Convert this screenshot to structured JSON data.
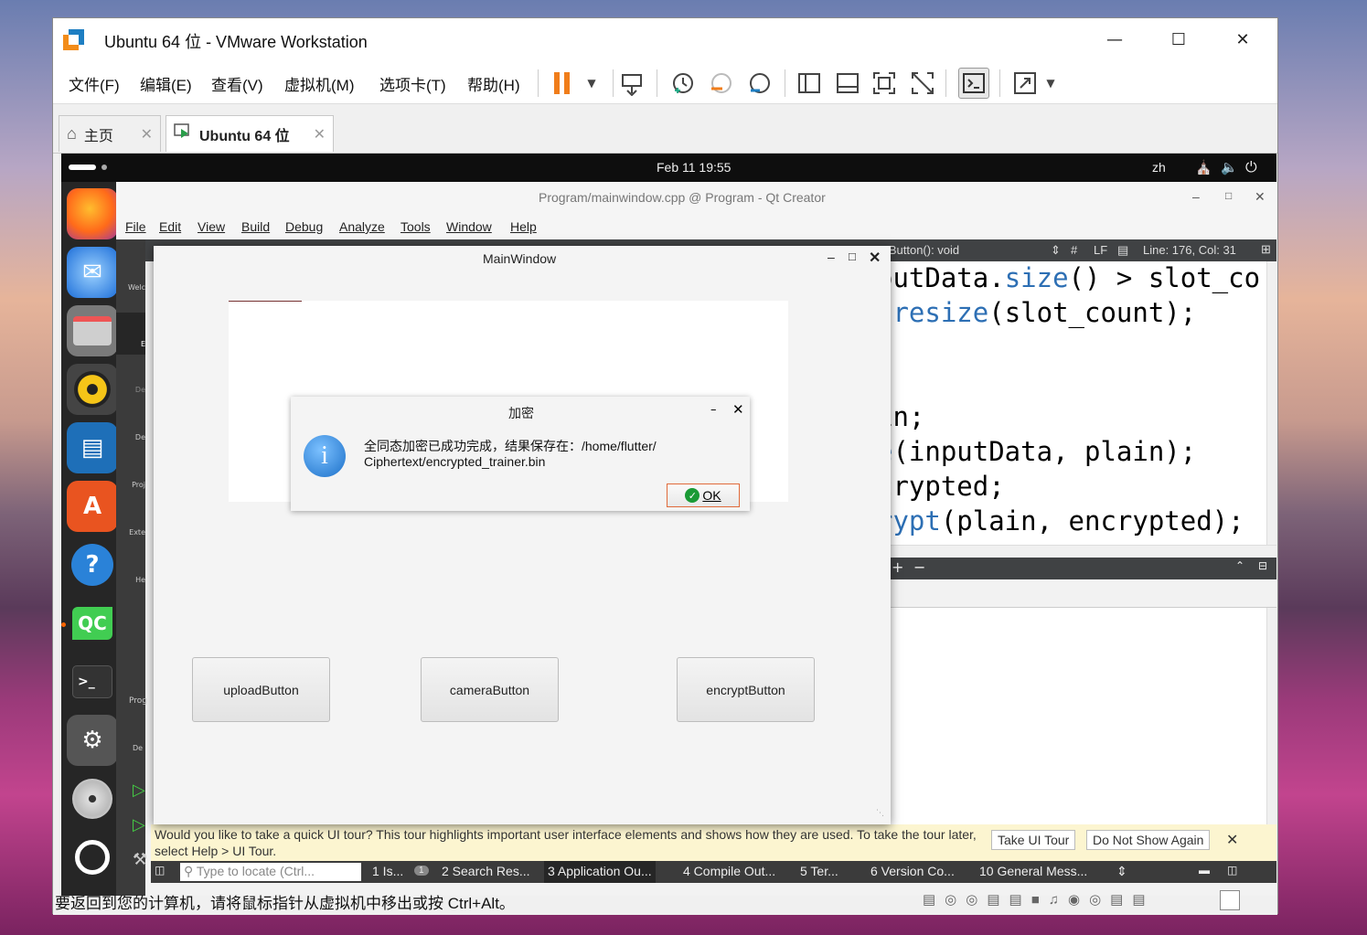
{
  "vmware": {
    "title": "Ubuntu 64 位 - VMware Workstation",
    "menu": [
      "文件(F)",
      "编辑(E)",
      "查看(V)",
      "虚拟机(M)",
      "选项卡(T)",
      "帮助(H)"
    ],
    "tabs": [
      {
        "label": "主页"
      },
      {
        "label": "Ubuntu 64 位"
      }
    ],
    "status_text": "要返回到您的计算机，请将鼠标指针从虚拟机中移出或按 Ctrl+Alt。"
  },
  "ubuntu": {
    "clock": "Feb 11  19:55",
    "lang": "zh",
    "dock_apps": [
      "firefox-icon",
      "thunderbird-icon",
      "files-icon",
      "rhythmbox-icon",
      "writer-icon",
      "app-center-icon",
      "help-icon",
      "qtcreator-icon",
      "terminal-icon",
      "settings-icon",
      "disc-icon",
      "ubuntu-icon"
    ]
  },
  "qtcreator": {
    "title": "Program/mainwindow.cpp @ Program - Qt Creator",
    "menu": [
      "File",
      "Edit",
      "View",
      "Build",
      "Debug",
      "Analyze",
      "Tools",
      "Window",
      "Help"
    ],
    "editor_function": "otButton(): void",
    "editor_hash": "#",
    "editor_lf": "LF",
    "editor_pos": "Line: 176, Col: 31",
    "code": [
      {
        "a": "outData.",
        "b": "size",
        "c": "() > slot_co"
      },
      {
        "a": ".",
        "b": "resize",
        "c": "(slot_count);"
      },
      {
        "a": "",
        "b": "",
        "c": ""
      },
      {
        "a": "",
        "b": "",
        "c": "in;"
      },
      {
        "a": "",
        "b": "e",
        "c": "(inputData, plain);"
      },
      {
        "a": "",
        "b": "",
        "c": "crypted;"
      },
      {
        "a": "",
        "b": "rypt",
        "c": "(plain, encrypted);"
      }
    ],
    "mode_labels": [
      "Welc",
      "E",
      "De",
      "De",
      "Proj",
      "Exte",
      "He",
      "Prog",
      "De"
    ],
    "tour_text": "Would you like to take a quick UI tour? This tour highlights important user interface elements and shows how they are used. To take the tour later, select Help > UI Tour.",
    "tour_btn": "Take UI Tour",
    "noshow_btn": "Do Not Show Again",
    "locate_placeholder": "Type to locate (Ctrl...",
    "output_tabs": [
      "1  Is...",
      "2  Search Res...",
      "3  Application Ou...",
      "4  Compile Out...",
      "5  Ter...",
      "6  Version Co...",
      "10 General Mess..."
    ],
    "issues_count": "1"
  },
  "mainwindow": {
    "title": "MainWindow",
    "buttons": [
      "uploadButton",
      "cameraButton",
      "encryptButton"
    ]
  },
  "dialog": {
    "title": "加密",
    "message1": "全同态加密已成功完成，结果保存在：/home/flutter/",
    "message2": "Ciphertext/encrypted_trainer.bin",
    "ok": "OK"
  }
}
